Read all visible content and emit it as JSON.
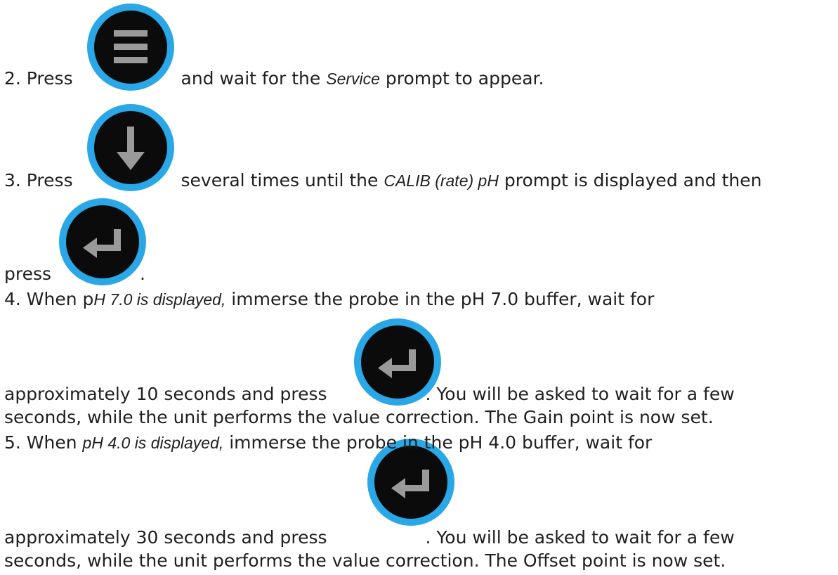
{
  "steps": [
    {
      "a": "2. Press ",
      "b": " and wait for the ",
      "em": "Service",
      "c": " prompt to appear."
    },
    {
      "a": "3. Press ",
      "b": " several times until the ",
      "em": "CALIB (rate) pH",
      "c": " prompt is displayed and then",
      "d": "press ",
      "e": "."
    },
    {
      "a": "4. When p",
      "em": "H 7.0 is displayed,",
      "b": " immerse the probe in the pH 7.0 buffer, wait for",
      "c": "approximately 10 seconds and press ",
      "d": ". You will be asked to wait for a few",
      "e": "seconds, while the unit performs the value correction. The Gain point is now set."
    },
    {
      "a": "5. When ",
      "em": "pH 4.0 is displayed,",
      "b": " immerse the probe in the pH 4.0 buffer, wait for",
      "c": "approximately 30 seconds and press ",
      "d": ". You will be asked to wait for a few",
      "e": "seconds, while the unit performs the value correction. The Offset point is now set."
    }
  ],
  "icons": {
    "menu": "menu-icon",
    "down": "arrow-down-icon",
    "enter": "enter-return-icon"
  },
  "colors": {
    "button_ring": "#2aa7e6",
    "button_face": "#0b0b0b",
    "glyph": "#9a9a9a",
    "text": "#1f1f1f"
  }
}
